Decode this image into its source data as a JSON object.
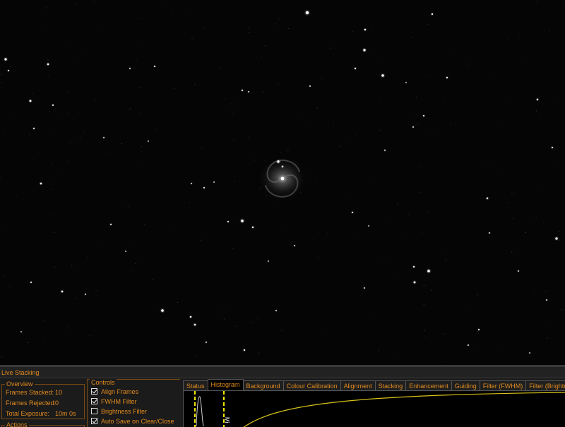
{
  "panel": {
    "title": "Live Stacking",
    "overview": {
      "legend": "Overview",
      "rows": [
        {
          "label": "Frames Stacked:",
          "value": "10"
        },
        {
          "label": "Frames Rejected:",
          "value": "0"
        },
        {
          "label": "Total Exposure:",
          "value": "10m 0s"
        }
      ]
    },
    "actions": {
      "legend": "Actions"
    },
    "controls": {
      "legend": "Controls",
      "items": [
        {
          "label": "Align Frames",
          "checked": true
        },
        {
          "label": "FWHM Filter",
          "checked": true
        },
        {
          "label": "Brightness Filter",
          "checked": false
        },
        {
          "label": "Auto Save on Clear/Close",
          "checked": true
        }
      ]
    },
    "tabs": [
      {
        "label": "Status",
        "active": false
      },
      {
        "label": "Histogram",
        "active": true
      },
      {
        "label": "Background",
        "active": false
      },
      {
        "label": "Colour Calibration",
        "active": false
      },
      {
        "label": "Alignment",
        "active": false
      },
      {
        "label": "Stacking",
        "active": false
      },
      {
        "label": "Enhancement",
        "active": false
      },
      {
        "label": "Guiding",
        "active": false
      },
      {
        "label": "Filter (FWHM)",
        "active": false
      },
      {
        "label": "Filter (Brightness)",
        "active": false
      }
    ],
    "histogram": {
      "mid_label": "Mi"
    }
  },
  "colors": {
    "accent": "#e08a1e",
    "curve": "#d8c21a",
    "marker": "#f2e600",
    "background": "#050505"
  }
}
